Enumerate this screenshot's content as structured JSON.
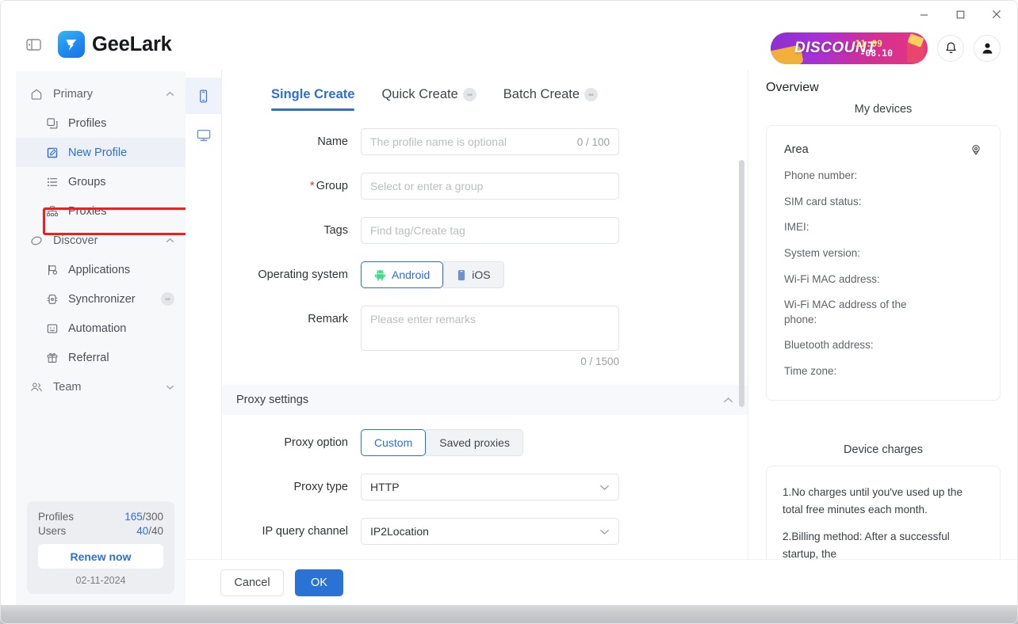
{
  "window": {
    "minimize_label": "minimize",
    "maximize_label": "maximize",
    "close_label": "close"
  },
  "header": {
    "brand_name": "GeeLark",
    "promo": {
      "word": "DISCOUNT",
      "date_start": "11.09",
      "date_end": "-08.10"
    }
  },
  "sidebar": {
    "groups": [
      {
        "label": "Primary",
        "expanded": true,
        "items": [
          {
            "label": "Profiles",
            "active": false,
            "locked": false
          },
          {
            "label": "New Profile",
            "active": true,
            "locked": false
          },
          {
            "label": "Groups",
            "active": false,
            "locked": false
          },
          {
            "label": "Proxies",
            "active": false,
            "locked": false
          }
        ]
      },
      {
        "label": "Discover",
        "expanded": true,
        "items": [
          {
            "label": "Applications",
            "active": false,
            "locked": false
          },
          {
            "label": "Synchronizer",
            "active": false,
            "locked": true
          },
          {
            "label": "Automation",
            "active": false,
            "locked": false
          },
          {
            "label": "Referral",
            "active": false,
            "locked": false
          }
        ]
      },
      {
        "label": "Team",
        "expanded": false,
        "items": []
      }
    ],
    "usage": {
      "profiles_label": "Profiles",
      "profiles_used": "165",
      "profiles_total": "/300",
      "users_label": "Users",
      "users_used": "40",
      "users_total": "/40",
      "renew_label": "Renew now",
      "date": "02-11-2024"
    }
  },
  "rail": {
    "phone_label": "phone-device",
    "desktop_label": "desktop-device"
  },
  "tabs": [
    {
      "label": "Single Create",
      "active": true,
      "locked": false
    },
    {
      "label": "Quick Create",
      "active": false,
      "locked": true
    },
    {
      "label": "Batch Create",
      "active": false,
      "locked": true
    }
  ],
  "form": {
    "name": {
      "label": "Name",
      "placeholder": "The profile name is optional",
      "value": "",
      "counter": "0 / 100"
    },
    "group": {
      "label": "Group",
      "required": true,
      "required_mark": "*",
      "placeholder": "Select or enter a group",
      "value": ""
    },
    "tags": {
      "label": "Tags",
      "placeholder": "Find tag/Create tag",
      "value": ""
    },
    "operating_system": {
      "label": "Operating system",
      "options": [
        {
          "label": "Android",
          "selected": true
        },
        {
          "label": "iOS",
          "selected": false
        }
      ]
    },
    "remark": {
      "label": "Remark",
      "placeholder": "Please enter remarks",
      "value": "",
      "counter": "0 / 1500"
    },
    "proxy_section": {
      "title": "Proxy settings",
      "expanded": true
    },
    "proxy_option": {
      "label": "Proxy option",
      "options": [
        {
          "label": "Custom",
          "selected": true
        },
        {
          "label": "Saved proxies",
          "selected": false
        }
      ]
    },
    "proxy_type": {
      "label": "Proxy type",
      "value": "HTTP"
    },
    "ip_query_channel": {
      "label": "IP query channel",
      "value": "IP2Location"
    }
  },
  "footer": {
    "cancel_label": "Cancel",
    "ok_label": "OK"
  },
  "overview": {
    "title": "Overview",
    "devices_heading": "My devices",
    "area_label": "Area",
    "device_fields": [
      "Phone number:",
      "SIM card status:",
      "IMEI:",
      "System version:",
      "Wi-Fi MAC address:",
      "Wi-Fi MAC address of the phone:",
      "Bluetooth address:",
      "Time zone:"
    ],
    "charges_heading": "Device charges",
    "charges_paragraphs": [
      "1.No charges until you've used up the total free minutes each month.",
      "2.Billing method: After a successful startup, the"
    ]
  },
  "colors": {
    "accent": "#2f6fd0",
    "primary_button": "#2a72d4",
    "annotation": "#f41c1c",
    "sidebar_bg": "#f7f8fa"
  }
}
